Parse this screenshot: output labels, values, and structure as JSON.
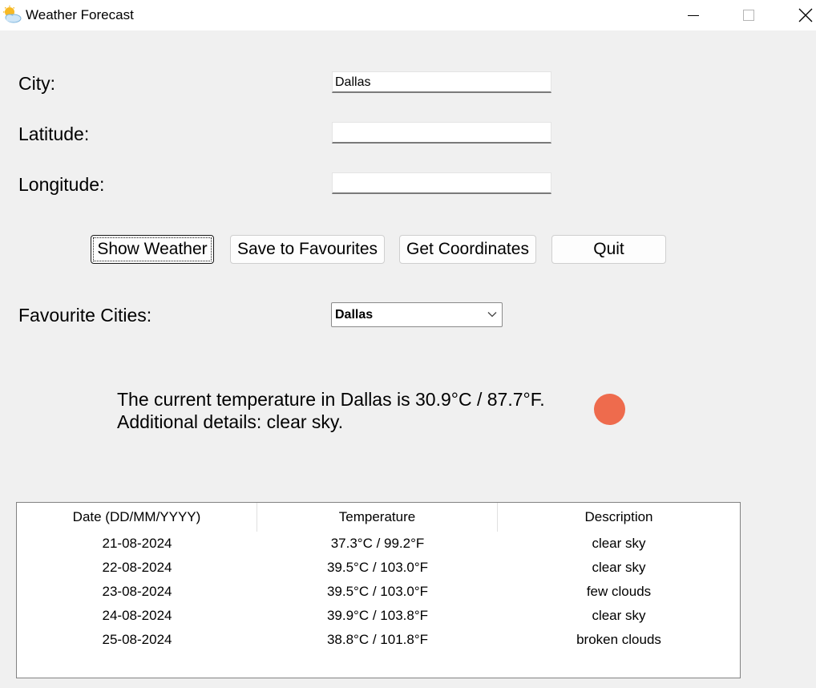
{
  "window": {
    "title": "Weather Forecast",
    "icon": "partly-cloudy-icon"
  },
  "form": {
    "city_label": "City:",
    "city_value": "Dallas",
    "latitude_label": "Latitude:",
    "latitude_value": "",
    "longitude_label": "Longitude:",
    "longitude_value": ""
  },
  "buttons": {
    "show_weather": "Show Weather",
    "save_favourites": "Save to Favourites",
    "get_coordinates": "Get Coordinates",
    "quit": "Quit"
  },
  "favourites": {
    "label": "Favourite Cities:",
    "selected": "Dallas"
  },
  "result": {
    "line1": "The current temperature in Dallas is 30.9°C / 87.7°F.",
    "line2": "Additional details: clear sky.",
    "indicator_color": "#ee6b4d"
  },
  "forecast": {
    "columns": [
      "Date (DD/MM/YYYY)",
      "Temperature",
      "Description"
    ],
    "rows": [
      [
        "21-08-2024",
        "37.3°C / 99.2°F",
        "clear sky"
      ],
      [
        "22-08-2024",
        "39.5°C / 103.0°F",
        "clear sky"
      ],
      [
        "23-08-2024",
        "39.5°C / 103.0°F",
        "few clouds"
      ],
      [
        "24-08-2024",
        "39.9°C / 103.8°F",
        "clear sky"
      ],
      [
        "25-08-2024",
        "38.8°C / 101.8°F",
        "broken clouds"
      ]
    ]
  }
}
